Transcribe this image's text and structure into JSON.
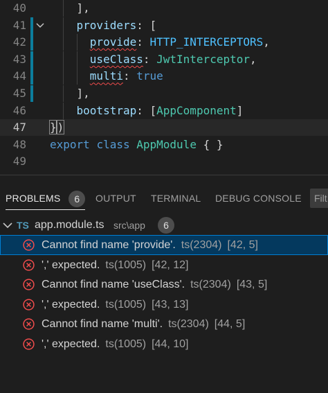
{
  "editor": {
    "lines": [
      {
        "num": "40",
        "indent": "    ",
        "tokens": [
          {
            "t": "],",
            "c": "p"
          }
        ]
      },
      {
        "num": "41",
        "indent": "    ",
        "tokens": [
          {
            "t": "providers",
            "c": "prop"
          },
          {
            "t": ": [",
            "c": "p"
          }
        ]
      },
      {
        "num": "42",
        "indent": "      ",
        "tokens": [
          {
            "t": "provide",
            "c": "prop",
            "sq": true
          },
          {
            "t": ": ",
            "c": "p"
          },
          {
            "t": "HTTP_INTERCEPTORS",
            "c": "const"
          },
          {
            "t": ",",
            "c": "p"
          }
        ]
      },
      {
        "num": "43",
        "indent": "      ",
        "tokens": [
          {
            "t": "useClass",
            "c": "prop",
            "sq": true
          },
          {
            "t": ": ",
            "c": "p"
          },
          {
            "t": "JwtInterceptor",
            "c": "cls"
          },
          {
            "t": ",",
            "c": "p"
          }
        ]
      },
      {
        "num": "44",
        "indent": "      ",
        "tokens": [
          {
            "t": "multi",
            "c": "prop",
            "sq": true
          },
          {
            "t": ": ",
            "c": "p"
          },
          {
            "t": "true",
            "c": "kw"
          }
        ]
      },
      {
        "num": "45",
        "indent": "    ",
        "tokens": [
          {
            "t": "],",
            "c": "p"
          }
        ]
      },
      {
        "num": "46",
        "indent": "    ",
        "tokens": [
          {
            "t": "bootstrap",
            "c": "prop"
          },
          {
            "t": ": [",
            "c": "p"
          },
          {
            "t": "AppComponent",
            "c": "cls"
          },
          {
            "t": "]",
            "c": "p"
          }
        ]
      },
      {
        "num": "47",
        "indent": "",
        "tokens": [
          {
            "t": "}",
            "c": "p",
            "box": true
          },
          {
            "t": ")",
            "c": "p",
            "box": true
          }
        ]
      },
      {
        "num": "48",
        "indent": "",
        "tokens": [
          {
            "t": "export",
            "c": "kw"
          },
          {
            "t": " ",
            "c": "p"
          },
          {
            "t": "class",
            "c": "kw"
          },
          {
            "t": " ",
            "c": "p"
          },
          {
            "t": "AppModule",
            "c": "cls"
          },
          {
            "t": " { }",
            "c": "p"
          }
        ]
      },
      {
        "num": "49",
        "indent": "",
        "tokens": []
      }
    ]
  },
  "panel": {
    "tabs": [
      {
        "label": "PROBLEMS",
        "badge": "6",
        "active": true
      },
      {
        "label": "OUTPUT"
      },
      {
        "label": "TERMINAL"
      },
      {
        "label": "DEBUG CONSOLE"
      }
    ],
    "filter_text": "Filt",
    "file": {
      "icon": "TS",
      "name": "app.module.ts",
      "path": "src\\app",
      "count": "6"
    },
    "problems": [
      {
        "message": "Cannot find name 'provide'.",
        "code": "ts(2304)",
        "position": "[42, 5]",
        "selected": true
      },
      {
        "message": "',' expected.",
        "code": "ts(1005)",
        "position": "[42, 12]"
      },
      {
        "message": "Cannot find name 'useClass'.",
        "code": "ts(2304)",
        "position": "[43, 5]"
      },
      {
        "message": "',' expected.",
        "code": "ts(1005)",
        "position": "[43, 13]"
      },
      {
        "message": "Cannot find name 'multi'.",
        "code": "ts(2304)",
        "position": "[44, 5]"
      },
      {
        "message": "',' expected.",
        "code": "ts(1005)",
        "position": "[44, 10]"
      }
    ]
  },
  "colors": {
    "error": "#f14c4c",
    "selection": "#04395e",
    "focus_border": "#007fd4",
    "modified_gutter": "#0c7d9d"
  },
  "icons": {
    "error": "error-circle-x-icon",
    "fold": "chevron-down-icon",
    "expand": "chevron-down-icon",
    "file": "typescript-file-icon"
  }
}
